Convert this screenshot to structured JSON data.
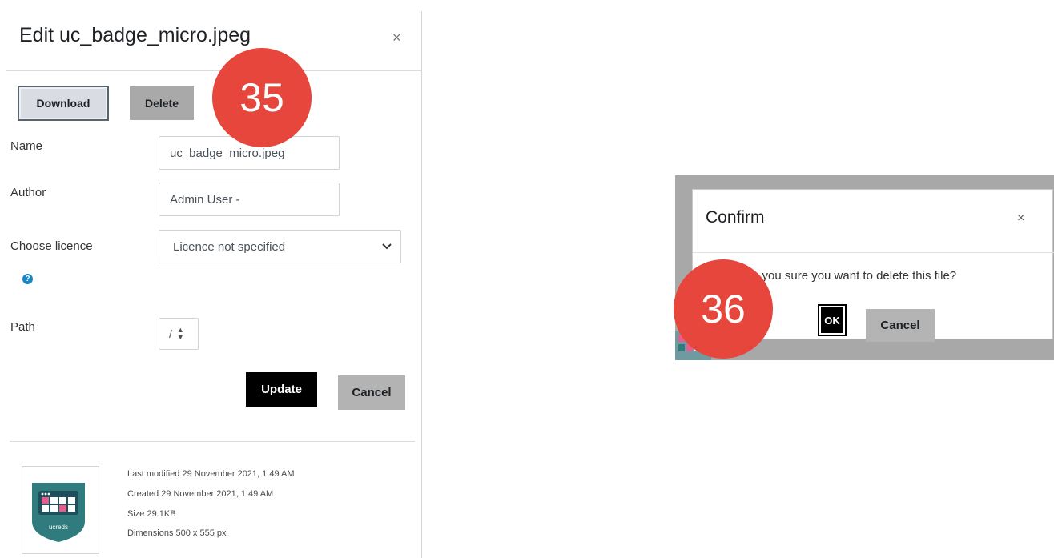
{
  "panel": {
    "title": "Edit uc_badge_micro.jpeg",
    "close_glyph": "×",
    "download_label": "Download",
    "delete_label": "Delete",
    "fields": {
      "name_label": "Name",
      "name_value": "uc_badge_micro.jpeg",
      "author_label": "Author",
      "author_value": "Admin User -",
      "licence_label": "Choose licence",
      "licence_value": "Licence not specified",
      "path_label": "Path",
      "path_value": "/"
    },
    "help_glyph": "?",
    "update_label": "Update",
    "cancel_label": "Cancel",
    "meta": {
      "last_modified": "Last modified  29 November 2021, 1:49 AM",
      "created": "Created  29 November 2021, 1:49 AM",
      "size": "Size  29.1KB",
      "dimensions": "Dimensions  500 x 555 px"
    },
    "badge_text": "ucreds"
  },
  "markers": {
    "step_35": "35",
    "step_36": "36"
  },
  "confirm": {
    "title": "Confirm",
    "close_glyph": "×",
    "message": "Are you sure you want to delete this file?",
    "ok_label": "OK",
    "cancel_label": "Cancel"
  },
  "colors": {
    "marker": "#e6463b",
    "primary_button": "#000000",
    "secondary_button": "#b3b3b3",
    "badge_teal": "#2f7b7d",
    "help_icon": "#1a86c4"
  },
  "icons": [
    "close-icon",
    "help-icon",
    "chevron-down-icon",
    "sort-arrows-icon"
  ]
}
